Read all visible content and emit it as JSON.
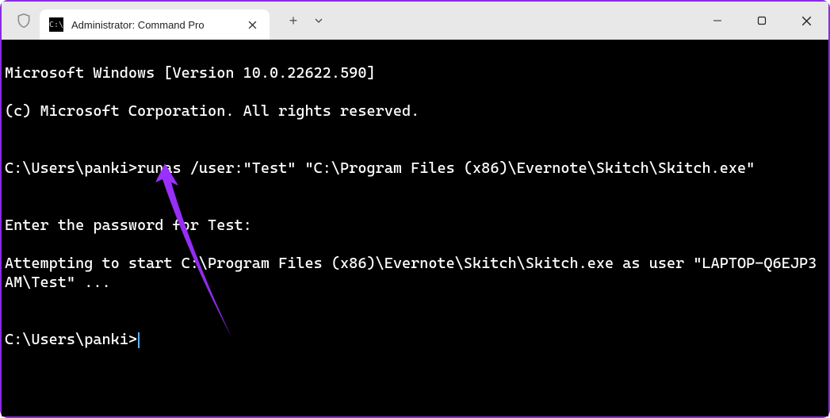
{
  "titlebar": {
    "tab_title": "Administrator: Command Pro",
    "shield_aria": "shield"
  },
  "terminal": {
    "line1": "Microsoft Windows [Version 10.0.22622.590]",
    "line2": "(c) Microsoft Corporation. All rights reserved.",
    "blank1": "",
    "prompt1_prefix": "C:\\Users\\panki>",
    "prompt1_cmd": "runas /user:\"Test\" \"C:\\Program Files (x86)\\Evernote\\Skitch\\Skitch.exe\"",
    "blank2": "",
    "line3": "Enter the password for Test:",
    "line4": "Attempting to start C:\\Program Files (x86)\\Evernote\\Skitch\\Skitch.exe as user \"LAPTOP-Q6EJP3AM\\Test\" ...",
    "blank3": "",
    "prompt2_prefix": "C:\\Users\\panki>"
  }
}
